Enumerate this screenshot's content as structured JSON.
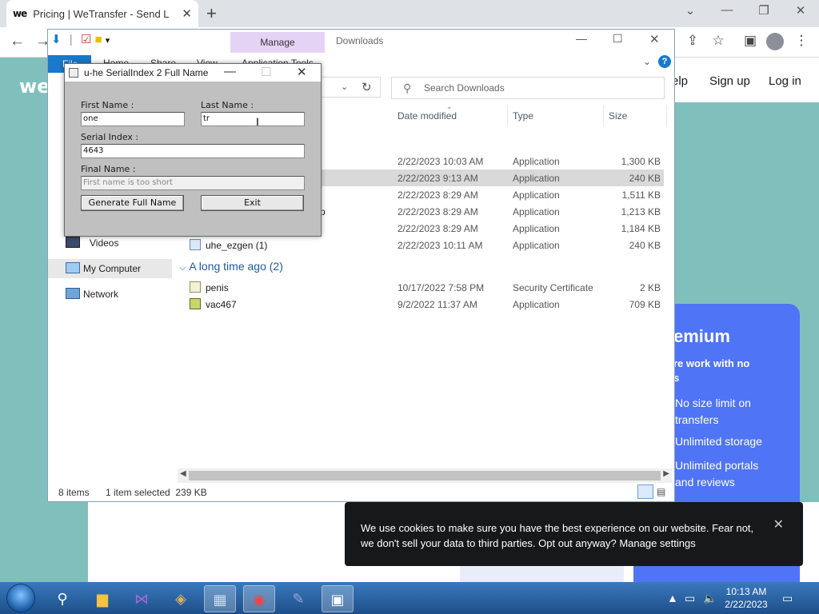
{
  "browser": {
    "tab_title": "Pricing | WeTransfer - Send Large Files",
    "tab_favicon": "we",
    "nav": {
      "back": "←",
      "forward": "→"
    }
  },
  "page": {
    "logo": "we",
    "nav_links": [
      "elp",
      "Sign up",
      "Log in"
    ],
    "premium": {
      "title": "emium",
      "subtitle": "re work with no\ns",
      "features": [
        "No size limit on transfers",
        "Unlimited storage",
        "Unlimited portals and reviews"
      ]
    },
    "cookie_banner": {
      "message": "We use cookies to make sure you have the best experience on our website. Fear not, we don't sell your data to third parties. Opt out anyway? Manage settings",
      "close": "✕"
    }
  },
  "explorer": {
    "manage_tab": "Manage",
    "title": "Downloads",
    "ribbon_tabs": [
      "File",
      "Home",
      "Share",
      "View",
      "Application Tools"
    ],
    "search_placeholder": "Search Downloads",
    "columns": [
      "Date modified",
      "Type",
      "Size"
    ],
    "files_recent": [
      {
        "name": "",
        "date": "2/22/2023 10:03 AM",
        "type": "Application",
        "size": "1,300 KB",
        "selected": false
      },
      {
        "name": "",
        "date": "2/22/2023 9:13 AM",
        "type": "Application",
        "size": "240 KB",
        "selected": true
      },
      {
        "name": "",
        "date": "2/22/2023 8:29 AM",
        "type": "Application",
        "size": "1,511 KB",
        "selected": false
      },
      {
        "name": "p",
        "date": "2/22/2023 8:29 AM",
        "type": "Application",
        "size": "1,213 KB",
        "selected": false
      },
      {
        "name": "",
        "date": "2/22/2023 8:29 AM",
        "type": "Application",
        "size": "1,184 KB",
        "selected": false
      },
      {
        "name": "uhe_ezgen (1)",
        "date": "2/22/2023 10:11 AM",
        "type": "Application",
        "size": "240 KB",
        "selected": false
      }
    ],
    "group_old": "A long time ago (2)",
    "files_old": [
      {
        "name": "penis",
        "date": "10/17/2022 7:58 PM",
        "type": "Security Certificate",
        "size": "2 KB"
      },
      {
        "name": "vac467",
        "date": "9/2/2022 11:37 AM",
        "type": "Application",
        "size": "709 KB"
      }
    ],
    "nav_pane": [
      "Videos",
      "My Computer",
      "Network"
    ],
    "status": {
      "items": "8 items",
      "selected": "1 item selected  239 KB"
    }
  },
  "dialog": {
    "title": "u-he SerialIndex 2 Full Name",
    "first_name_label": "First Name :",
    "first_name_value": "one",
    "last_name_label": "Last Name :",
    "last_name_value": "tr",
    "serial_label": "Serial Index :",
    "serial_value": "4643",
    "final_label": "Final Name :",
    "final_value": "First name is too short",
    "generate_button": "Generate Full Name",
    "exit_button": "Exit"
  },
  "taskbar": {
    "time": "10:13 AM",
    "date": "2/22/2023"
  },
  "colors": {
    "page_bg": "#7fc0bd",
    "premium_blue": "#4f74f5",
    "manage_tab": "#e5d3f5",
    "file_tab": "#1979ca",
    "dialog_gray": "#c0c0c0",
    "taskbar": "#2c67a7"
  }
}
